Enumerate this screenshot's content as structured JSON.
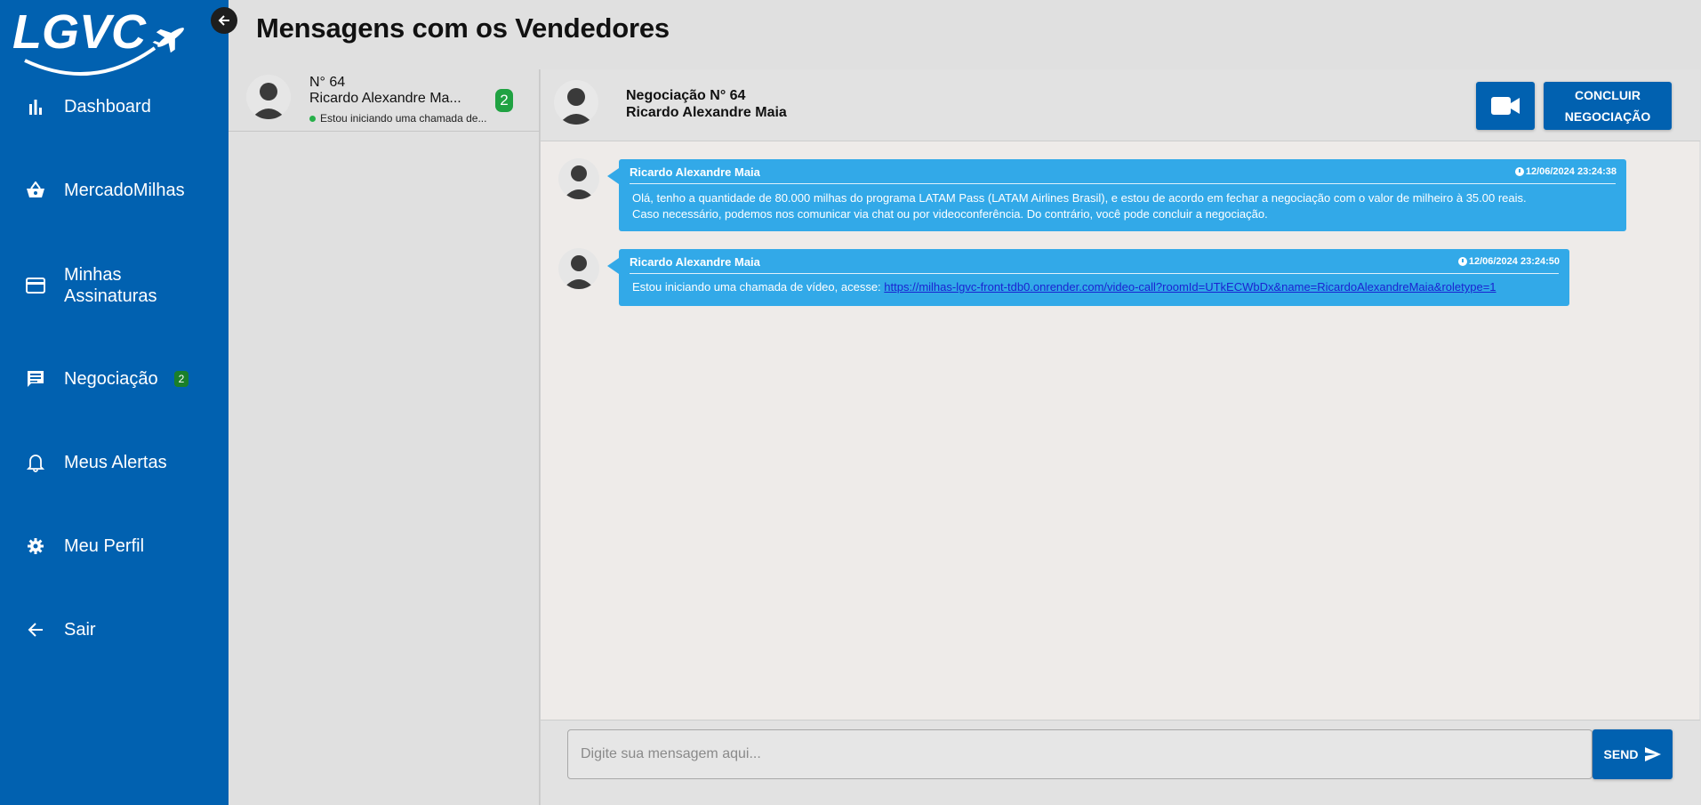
{
  "brand": {
    "logo_text": "LGVC"
  },
  "sidebar": {
    "items": [
      {
        "label": "Dashboard",
        "icon": "bar-chart-icon"
      },
      {
        "label": "MercadoMilhas",
        "icon": "basket-icon"
      },
      {
        "label": "Minhas\nAssinaturas",
        "icon": "credit-card-icon"
      },
      {
        "label": "Negociação",
        "icon": "chat-icon",
        "badge": "2"
      },
      {
        "label": "Meus Alertas",
        "icon": "bell-icon"
      },
      {
        "label": "Meu Perfil",
        "icon": "gear-icon"
      },
      {
        "label": "Sair",
        "icon": "arrow-left-icon"
      }
    ]
  },
  "page": {
    "title": "Mensagens com os Vendedores"
  },
  "conversations": [
    {
      "number": "N° 64",
      "name": "Ricardo Alexandre Ma...",
      "preview": "Estou iniciando uma chamada de...",
      "unread": "2"
    }
  ],
  "chat": {
    "title": "Negociação N° 64",
    "subtitle": "Ricardo Alexandre Maia",
    "conclude_label": "CONCLUIR NEGOCIAÇÃO",
    "messages": [
      {
        "sender": "Ricardo Alexandre Maia",
        "time": "12/06/2024 23:24:38",
        "line1": "Olá, tenho a quantidade de 80.000 milhas do programa LATAM Pass (LATAM Airlines Brasil), e estou de acordo em fechar a negociação com o valor de milheiro à 35.00 reais.",
        "line2": "Caso necessário, podemos nos comunicar via chat ou por videoconferência. Do contrário, você pode concluir a negociação."
      },
      {
        "sender": "Ricardo Alexandre Maia",
        "time": "12/06/2024 23:24:50",
        "text": "Estou iniciando uma chamada de vídeo, acesse: ",
        "link": "https://milhas-lgvc-front-tdb0.onrender.com/video-call?roomId=UTkECWbDx&name=RicardoAlexandreMaia&roletype=1"
      }
    ]
  },
  "composer": {
    "placeholder": "Digite sua mensagem aqui...",
    "value": "",
    "send_label": "SEND"
  },
  "colors": {
    "sidebar": "#0161b0",
    "bubble": "#32a9e8",
    "badge": "#20a242",
    "online": "#27b04a"
  }
}
